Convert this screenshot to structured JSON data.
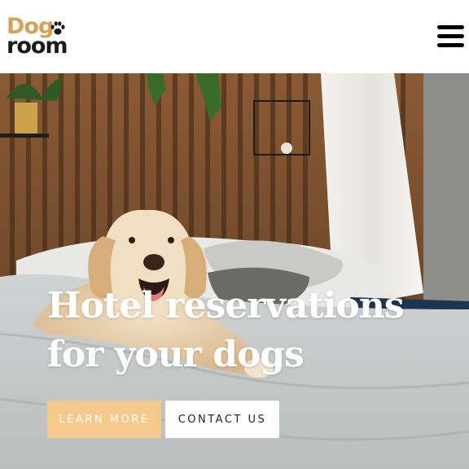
{
  "header": {
    "logo": {
      "word_top": "Dog",
      "word_bottom": "room",
      "icon": "paw-icon"
    },
    "menu_icon": "hamburger-menu-icon"
  },
  "hero": {
    "title_line1": "Hotel reservations",
    "title_line2": "for your dogs",
    "learn_more_label": "LEARN MORE",
    "contact_label": "CONTACT US"
  },
  "colors": {
    "accent": "#f4c98b",
    "logo_gold": "#d6a15a",
    "text_dark": "#1a1a1a"
  }
}
